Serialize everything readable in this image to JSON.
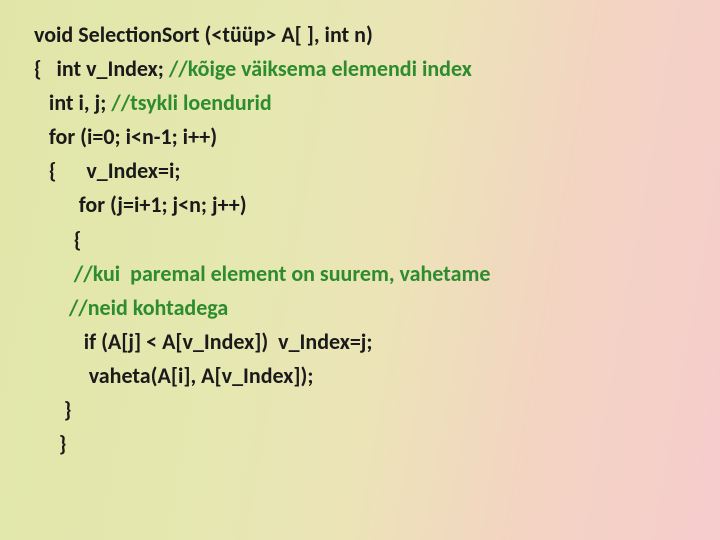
{
  "code": {
    "l1a": "void SelectionSort (<tüüp> A[ ], int n)",
    "l2a": "{   int v_Index; ",
    "l2b": "//kõige väiksema elemendi index",
    "l3a": "   int i, j; ",
    "l3b": "//tsykli loendurid",
    "l4a": "   for (i=0; i<n-1; i++)",
    "l5a": "   {      v_Index=i;",
    "l6a": "         for (j=i+1; j<n; j++)",
    "l7a": "        {",
    "l8a": "        //kui  paremal element on suurem, vahetame",
    "l9a": "       //neid kohtadega",
    "l10a": "          if (A[j] < A[v_Index])  v_Index=j;",
    "l11a": "           vaheta(A[i], A[v_Index]);",
    "l12a": "      }",
    "l13a": "     }"
  }
}
